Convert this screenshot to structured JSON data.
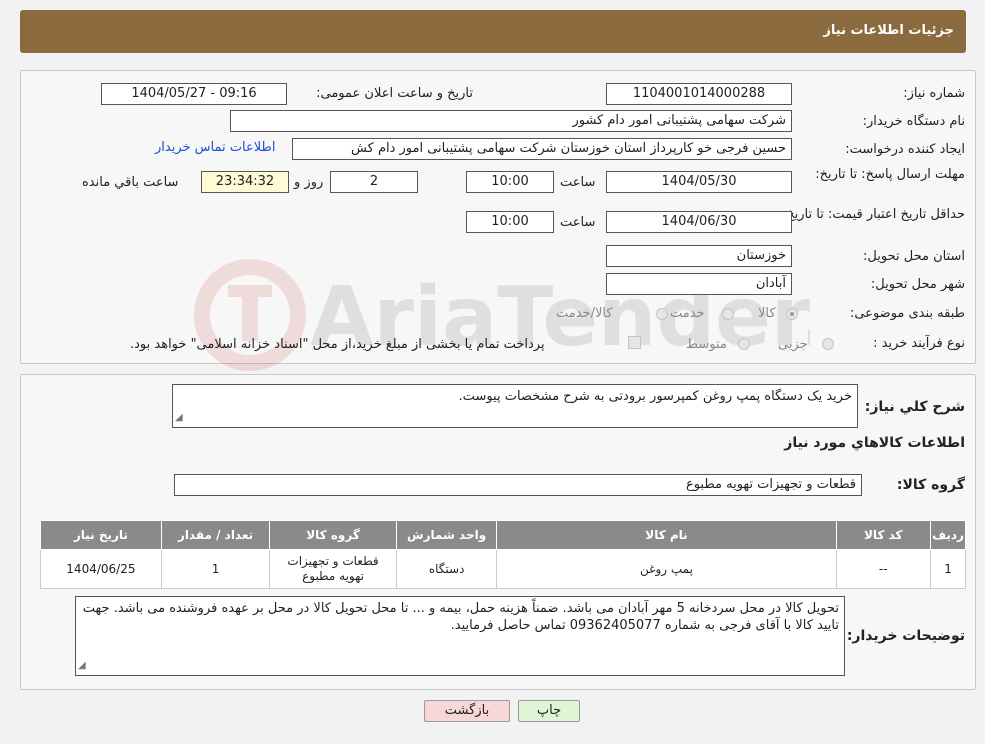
{
  "header": {
    "title": "جزئیات اطلاعات نیاز"
  },
  "form": {
    "need_number_label": "شماره نیاز:",
    "need_number": "1104001014000288",
    "announce_label": "تاریخ و ساعت اعلان عمومی:",
    "announce_value": "1404/05/27 - 09:16",
    "buyer_label": "نام دستگاه خریدار:",
    "buyer_value": "شرکت سهامی پشتیبانی امور دام کشور",
    "creator_label": "ایجاد کننده درخواست:",
    "creator_value": "حسین فرجی خو کارپرداز استان خوزستان شرکت سهامی پشتیبانی امور دام کش",
    "contact_link": "اطلاعات تماس خریدار",
    "deadline_label": "مهلت ارسال پاسخ: تا تاریخ:",
    "deadline_date": "1404/05/30",
    "time_label": "ساعت",
    "deadline_time": "10:00",
    "days_value": "2",
    "days_label": "روز و",
    "remaining_time": "23:34:32",
    "remaining_label": "ساعت باقي مانده",
    "validity_label": "حداقل تاریخ اعتبار قیمت: تا تاریخ:",
    "validity_date": "1404/06/30",
    "validity_time": "10:00",
    "province_label": "استان محل تحویل:",
    "province_value": "خوزستان",
    "city_label": "شهر محل تحویل:",
    "city_value": "آبادان",
    "category_label": "طبقه بندی موضوعی:",
    "category_options": [
      "کالا",
      "خدمت",
      "کالا/خدمت"
    ],
    "process_label": "نوع فرآیند خرید :",
    "process_options": [
      "جزیی",
      "متوسط"
    ],
    "process_note": "پرداخت تمام یا بخشی از مبلغ خرید،از محل \"اسناد خزانه اسلامی\" خواهد بود."
  },
  "summary": {
    "desc_label": "شرح کلي نياز:",
    "desc_value": "خرید یک دستگاه پمپ روغن کمپرسور برودتی به شرح مشخصات پیوست.",
    "items_title": "اطلاعات کالاهاي مورد نياز",
    "group_label": "گروه کالا:",
    "group_value": "قطعات و تجهیزات تهویه مطبوع",
    "table": {
      "headers": [
        "ردیف",
        "کد کالا",
        "نام کالا",
        "واحد شمارش",
        "گروه کالا",
        "تعداد / مقدار",
        "تاریخ نیاز"
      ],
      "rows": [
        [
          "1",
          "--",
          "پمپ روغن",
          "دستگاه",
          "قطعات و تجهیزات تهویه مطبوع",
          "1",
          "1404/06/25"
        ]
      ]
    },
    "notes_label": "توضیحات خریدار:",
    "notes_value": "تحویل کالا در محل سردخانه 5 مهر آبادان می باشد. ضمناً هزینه حمل، بیمه و ... تا محل تحویل کالا در محل بر عهده فروشنده می باشد. جهت تایید کالا با آقای فرجی به شماره 09362405077 تماس حاصل فرمایید."
  },
  "buttons": {
    "print": "چاپ",
    "back": "بازگشت"
  },
  "watermark": "AriaTender.neT",
  "colors": {
    "header_bg": "#8b6b3e",
    "link": "#1a4fd1",
    "back_btn": "#f7d7d7",
    "print_btn": "#dff5d6"
  }
}
